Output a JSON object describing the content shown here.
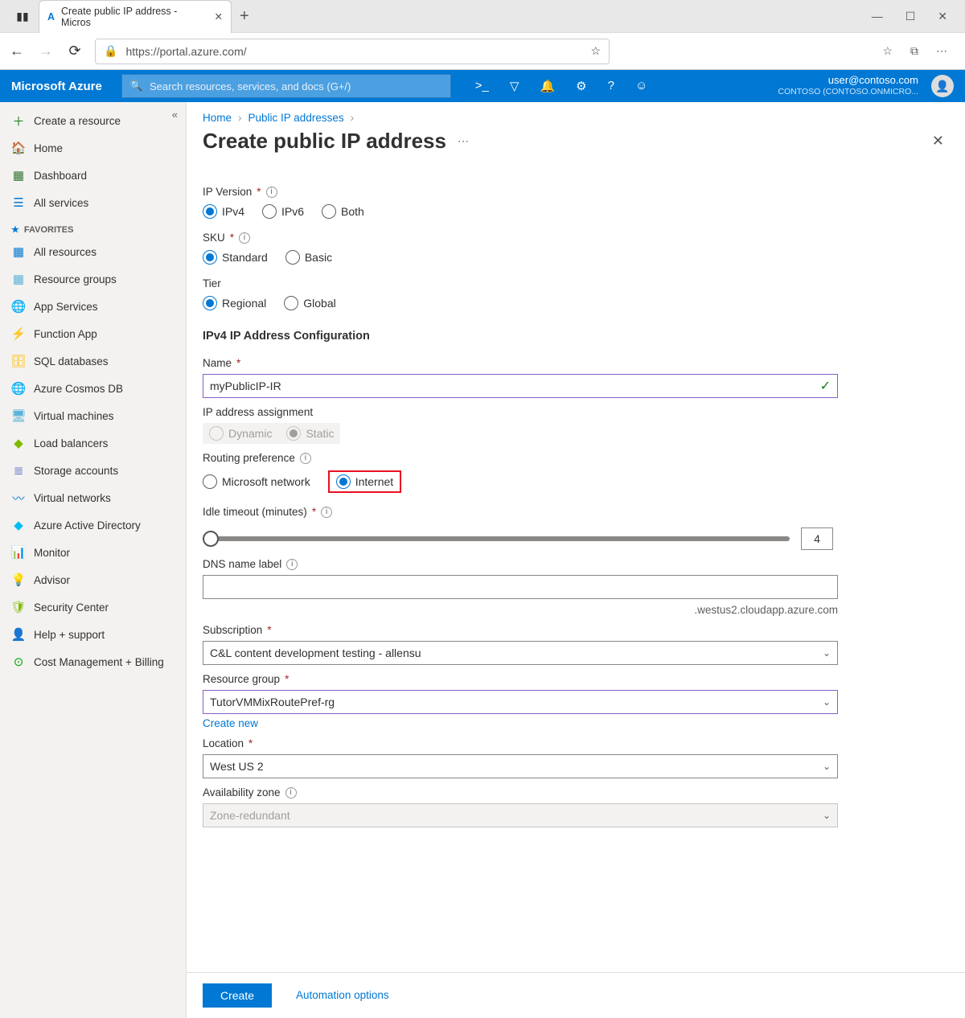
{
  "browser": {
    "tab_title": "Create public IP address - Micros",
    "url": "https://portal.azure.com/"
  },
  "azure_bar": {
    "logo": "Microsoft Azure",
    "search_placeholder": "Search resources, services, and docs (G+/)",
    "user_email": "user@contoso.com",
    "user_directory": "CONTOSO (CONTOSO.ONMICRO..."
  },
  "sidebar": {
    "create": "Create a resource",
    "home": "Home",
    "dashboard": "Dashboard",
    "all_services": "All services",
    "favorites_label": "FAVORITES",
    "items": [
      "All resources",
      "Resource groups",
      "App Services",
      "Function App",
      "SQL databases",
      "Azure Cosmos DB",
      "Virtual machines",
      "Load balancers",
      "Storage accounts",
      "Virtual networks",
      "Azure Active Directory",
      "Monitor",
      "Advisor",
      "Security Center",
      "Help + support",
      "Cost Management + Billing"
    ]
  },
  "breadcrumbs": {
    "home": "Home",
    "parent": "Public IP addresses"
  },
  "page_title": "Create public IP address",
  "form": {
    "ip_version": {
      "label": "IP Version",
      "opts": [
        "IPv4",
        "IPv6",
        "Both"
      ],
      "selected": "IPv4"
    },
    "sku": {
      "label": "SKU",
      "opts": [
        "Standard",
        "Basic"
      ],
      "selected": "Standard"
    },
    "tier": {
      "label": "Tier",
      "opts": [
        "Regional",
        "Global"
      ],
      "selected": "Regional"
    },
    "section": "IPv4 IP Address Configuration",
    "name": {
      "label": "Name",
      "value": "myPublicIP-IR"
    },
    "assignment": {
      "label": "IP address assignment",
      "opts": [
        "Dynamic",
        "Static"
      ],
      "selected": "Static"
    },
    "routing": {
      "label": "Routing preference",
      "opts": [
        "Microsoft network",
        "Internet"
      ],
      "selected": "Internet"
    },
    "idle": {
      "label": "Idle timeout (minutes)",
      "value": "4"
    },
    "dns": {
      "label": "DNS name label",
      "value": "",
      "suffix": ".westus2.cloudapp.azure.com"
    },
    "subscription": {
      "label": "Subscription",
      "value": "C&L content development testing - allensu"
    },
    "rg": {
      "label": "Resource group",
      "value": "TutorVMMixRoutePref-rg",
      "create_new": "Create new"
    },
    "location": {
      "label": "Location",
      "value": "West US 2"
    },
    "az": {
      "label": "Availability zone",
      "value": "Zone-redundant"
    }
  },
  "footer": {
    "create": "Create",
    "automation": "Automation options"
  },
  "icon_colors": [
    "#0078d4",
    "#59b4d9",
    "#7fba00",
    "#b4a0ff",
    "#ffb900",
    "#0078d4",
    "#59b4d9",
    "#7fba00",
    "#5c6bc0",
    "#0078d4",
    "#00bcf2",
    "#804998",
    "#0078d4",
    "#7fba00",
    "#0078d4",
    "#00a300"
  ]
}
